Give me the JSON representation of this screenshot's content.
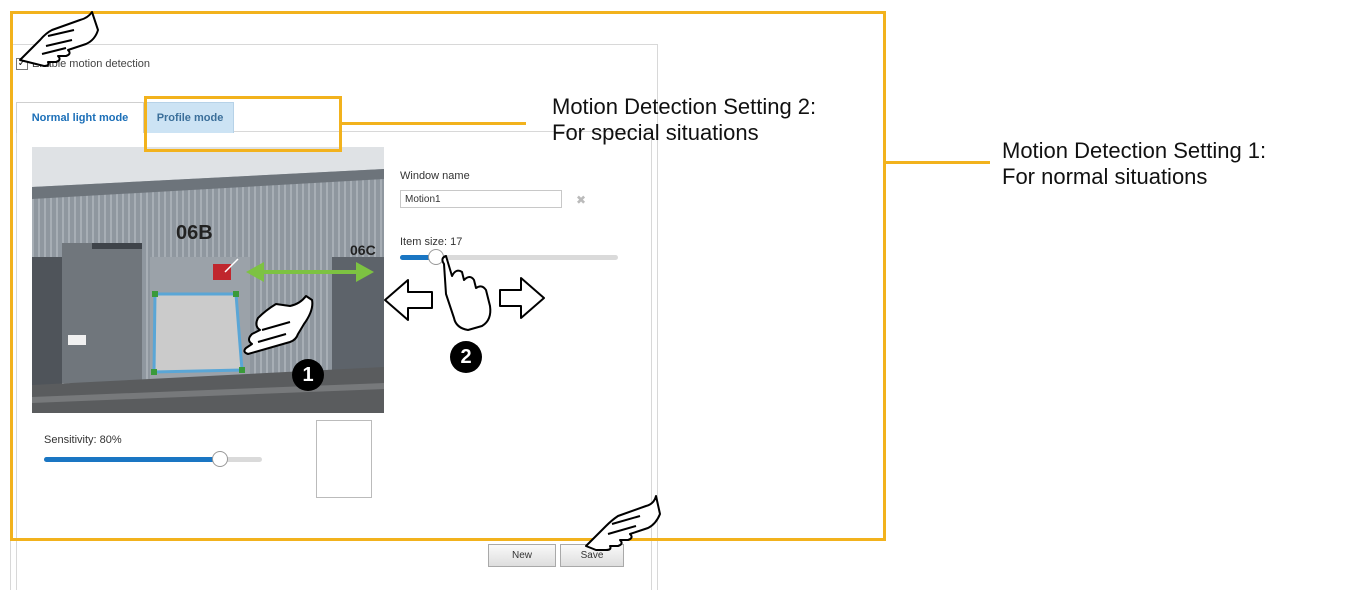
{
  "enable_motion": {
    "label": "Enable motion detection",
    "checked": true
  },
  "tabs": [
    {
      "label": "Normal light mode",
      "active": true
    },
    {
      "label": "Profile mode",
      "active": false
    }
  ],
  "video": {
    "building_labels": [
      "06B",
      "06C"
    ]
  },
  "window_panel": {
    "window_name_label": "Window name",
    "window_name_value": "Motion1",
    "item_size_label": "Item size: 17",
    "item_size_value": 17
  },
  "sensitivity": {
    "label": "Sensitivity: 80%",
    "value": 80
  },
  "buttons": {
    "new_label": "New",
    "save_label": "Save"
  },
  "callouts": {
    "setting2_line1": "Motion Detection Setting 2:",
    "setting2_line2": "For special situations",
    "setting1_line1": "Motion Detection Setting 1:",
    "setting1_line2": "For normal situations"
  },
  "badges": {
    "step1": "1",
    "step2": "2"
  },
  "colors": {
    "highlight": "#f2b21d",
    "slider": "#1a76c3",
    "arrow": "#7dc242",
    "active_tab": "#cce3f4"
  },
  "icons": [
    "pointing-hand-icon",
    "checkmark-icon",
    "delete-icon",
    "left-arrow-icon",
    "right-arrow-icon",
    "double-arrow-icon"
  ]
}
